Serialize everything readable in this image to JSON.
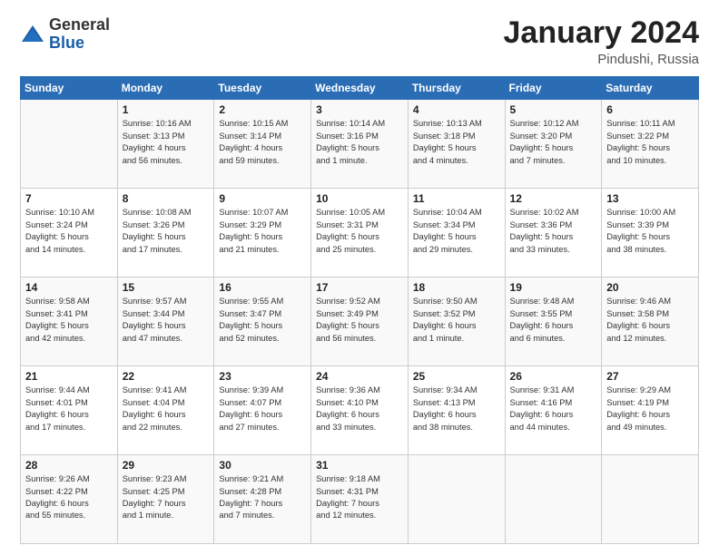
{
  "logo": {
    "general": "General",
    "blue": "Blue"
  },
  "header": {
    "month": "January 2024",
    "location": "Pindushi, Russia"
  },
  "weekdays": [
    "Sunday",
    "Monday",
    "Tuesday",
    "Wednesday",
    "Thursday",
    "Friday",
    "Saturday"
  ],
  "weeks": [
    [
      {
        "day": "",
        "info": ""
      },
      {
        "day": "1",
        "info": "Sunrise: 10:16 AM\nSunset: 3:13 PM\nDaylight: 4 hours\nand 56 minutes."
      },
      {
        "day": "2",
        "info": "Sunrise: 10:15 AM\nSunset: 3:14 PM\nDaylight: 4 hours\nand 59 minutes."
      },
      {
        "day": "3",
        "info": "Sunrise: 10:14 AM\nSunset: 3:16 PM\nDaylight: 5 hours\nand 1 minute."
      },
      {
        "day": "4",
        "info": "Sunrise: 10:13 AM\nSunset: 3:18 PM\nDaylight: 5 hours\nand 4 minutes."
      },
      {
        "day": "5",
        "info": "Sunrise: 10:12 AM\nSunset: 3:20 PM\nDaylight: 5 hours\nand 7 minutes."
      },
      {
        "day": "6",
        "info": "Sunrise: 10:11 AM\nSunset: 3:22 PM\nDaylight: 5 hours\nand 10 minutes."
      }
    ],
    [
      {
        "day": "7",
        "info": "Sunrise: 10:10 AM\nSunset: 3:24 PM\nDaylight: 5 hours\nand 14 minutes."
      },
      {
        "day": "8",
        "info": "Sunrise: 10:08 AM\nSunset: 3:26 PM\nDaylight: 5 hours\nand 17 minutes."
      },
      {
        "day": "9",
        "info": "Sunrise: 10:07 AM\nSunset: 3:29 PM\nDaylight: 5 hours\nand 21 minutes."
      },
      {
        "day": "10",
        "info": "Sunrise: 10:05 AM\nSunset: 3:31 PM\nDaylight: 5 hours\nand 25 minutes."
      },
      {
        "day": "11",
        "info": "Sunrise: 10:04 AM\nSunset: 3:34 PM\nDaylight: 5 hours\nand 29 minutes."
      },
      {
        "day": "12",
        "info": "Sunrise: 10:02 AM\nSunset: 3:36 PM\nDaylight: 5 hours\nand 33 minutes."
      },
      {
        "day": "13",
        "info": "Sunrise: 10:00 AM\nSunset: 3:39 PM\nDaylight: 5 hours\nand 38 minutes."
      }
    ],
    [
      {
        "day": "14",
        "info": "Sunrise: 9:58 AM\nSunset: 3:41 PM\nDaylight: 5 hours\nand 42 minutes."
      },
      {
        "day": "15",
        "info": "Sunrise: 9:57 AM\nSunset: 3:44 PM\nDaylight: 5 hours\nand 47 minutes."
      },
      {
        "day": "16",
        "info": "Sunrise: 9:55 AM\nSunset: 3:47 PM\nDaylight: 5 hours\nand 52 minutes."
      },
      {
        "day": "17",
        "info": "Sunrise: 9:52 AM\nSunset: 3:49 PM\nDaylight: 5 hours\nand 56 minutes."
      },
      {
        "day": "18",
        "info": "Sunrise: 9:50 AM\nSunset: 3:52 PM\nDaylight: 6 hours\nand 1 minute."
      },
      {
        "day": "19",
        "info": "Sunrise: 9:48 AM\nSunset: 3:55 PM\nDaylight: 6 hours\nand 6 minutes."
      },
      {
        "day": "20",
        "info": "Sunrise: 9:46 AM\nSunset: 3:58 PM\nDaylight: 6 hours\nand 12 minutes."
      }
    ],
    [
      {
        "day": "21",
        "info": "Sunrise: 9:44 AM\nSunset: 4:01 PM\nDaylight: 6 hours\nand 17 minutes."
      },
      {
        "day": "22",
        "info": "Sunrise: 9:41 AM\nSunset: 4:04 PM\nDaylight: 6 hours\nand 22 minutes."
      },
      {
        "day": "23",
        "info": "Sunrise: 9:39 AM\nSunset: 4:07 PM\nDaylight: 6 hours\nand 27 minutes."
      },
      {
        "day": "24",
        "info": "Sunrise: 9:36 AM\nSunset: 4:10 PM\nDaylight: 6 hours\nand 33 minutes."
      },
      {
        "day": "25",
        "info": "Sunrise: 9:34 AM\nSunset: 4:13 PM\nDaylight: 6 hours\nand 38 minutes."
      },
      {
        "day": "26",
        "info": "Sunrise: 9:31 AM\nSunset: 4:16 PM\nDaylight: 6 hours\nand 44 minutes."
      },
      {
        "day": "27",
        "info": "Sunrise: 9:29 AM\nSunset: 4:19 PM\nDaylight: 6 hours\nand 49 minutes."
      }
    ],
    [
      {
        "day": "28",
        "info": "Sunrise: 9:26 AM\nSunset: 4:22 PM\nDaylight: 6 hours\nand 55 minutes."
      },
      {
        "day": "29",
        "info": "Sunrise: 9:23 AM\nSunset: 4:25 PM\nDaylight: 7 hours\nand 1 minute."
      },
      {
        "day": "30",
        "info": "Sunrise: 9:21 AM\nSunset: 4:28 PM\nDaylight: 7 hours\nand 7 minutes."
      },
      {
        "day": "31",
        "info": "Sunrise: 9:18 AM\nSunset: 4:31 PM\nDaylight: 7 hours\nand 12 minutes."
      },
      {
        "day": "",
        "info": ""
      },
      {
        "day": "",
        "info": ""
      },
      {
        "day": "",
        "info": ""
      }
    ]
  ]
}
